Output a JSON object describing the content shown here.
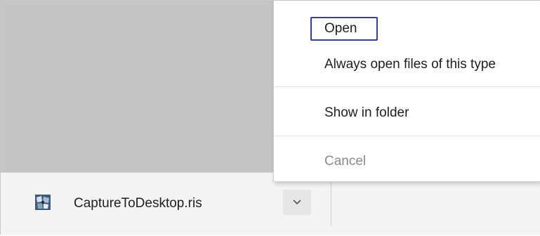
{
  "download": {
    "file_name": "CaptureToDesktop.ris",
    "file_icon": "application-file-icon",
    "menu_toggle_icon": "chevron-down-icon"
  },
  "context_menu": {
    "items": [
      {
        "label": "Open",
        "enabled": true,
        "focused": true
      },
      {
        "label": "Always open files of this type",
        "enabled": true,
        "focused": false
      },
      {
        "label": "Show in folder",
        "enabled": true,
        "focused": false
      },
      {
        "label": "Cancel",
        "enabled": false,
        "focused": false
      }
    ]
  },
  "colors": {
    "page_background": "#c5c5c5",
    "shelf_background": "#f4f4f4",
    "menu_background": "#ffffff",
    "focus_ring": "#3a3aa3",
    "disabled_text": "#8b8b8b"
  }
}
